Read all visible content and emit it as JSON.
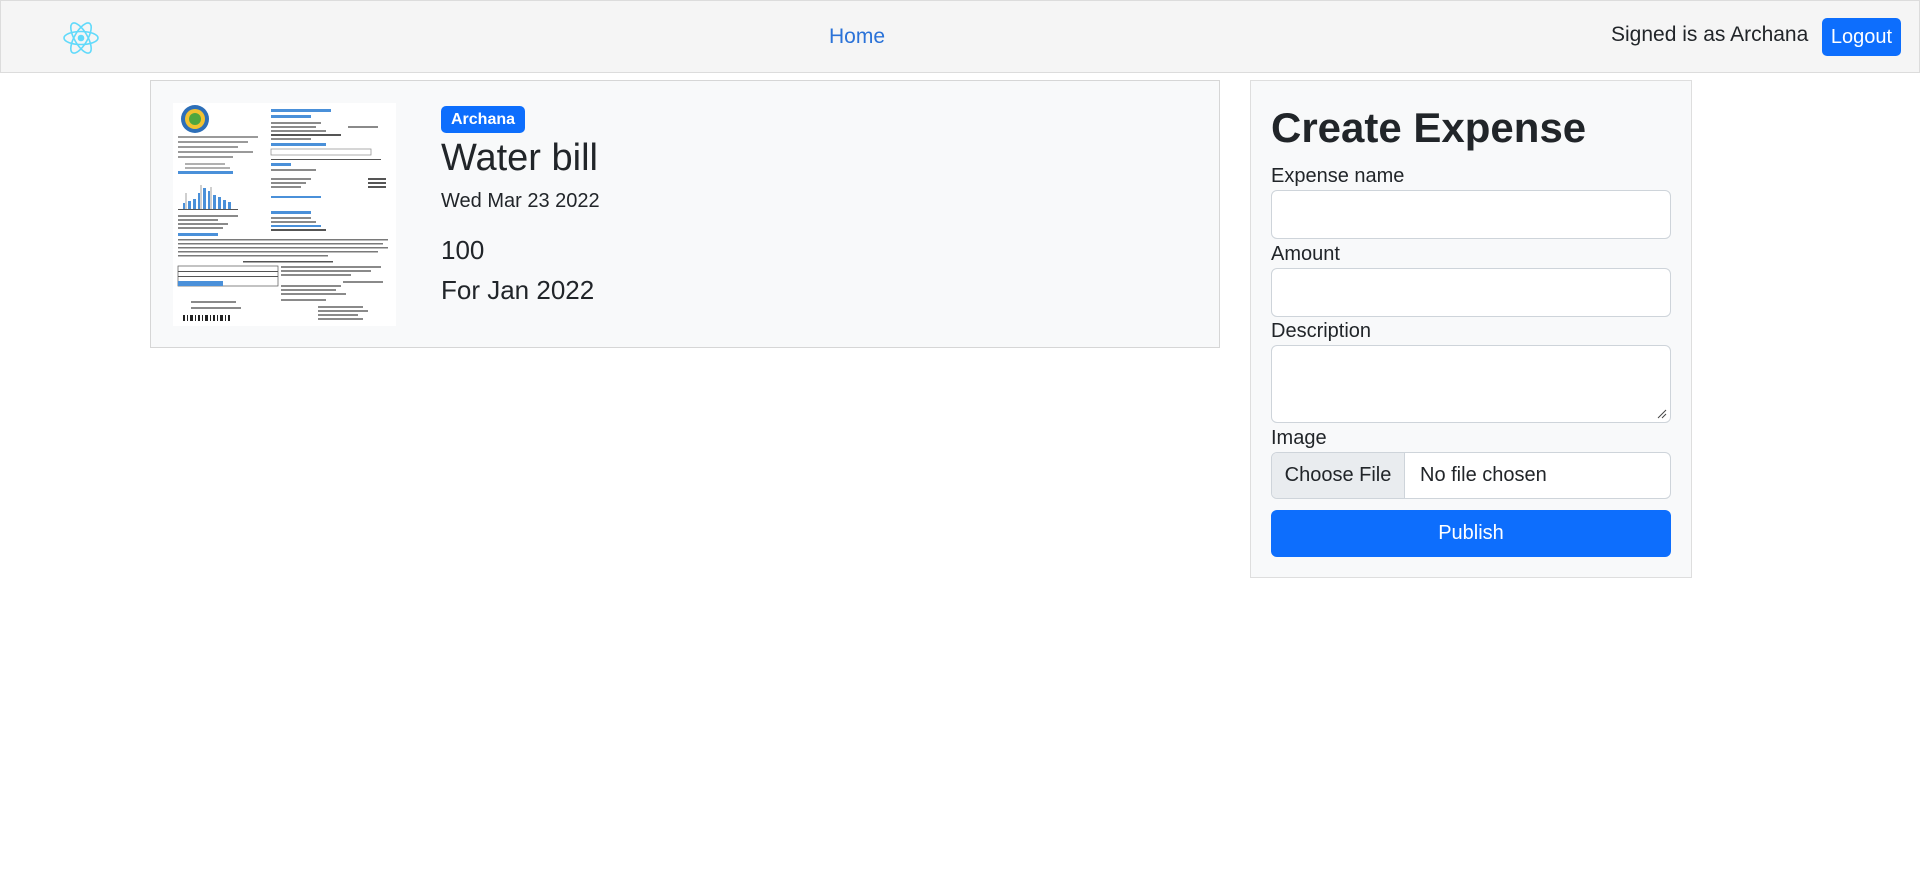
{
  "navbar": {
    "logo_icon": "react-logo-icon",
    "home_link": "Home",
    "signed_in_text": "Signed is as Archana",
    "logout_label": "Logout"
  },
  "expense": {
    "author_badge": "Archana",
    "title": "Water bill",
    "date": "Wed Mar 23 2022",
    "amount": "100",
    "description": "For Jan 2022"
  },
  "form": {
    "title": "Create Expense",
    "name_label": "Expense name",
    "amount_label": "Amount",
    "description_label": "Description",
    "image_label": "Image",
    "file_button_label": "Choose File",
    "file_status": "No file chosen",
    "publish_label": "Publish"
  },
  "colors": {
    "primary": "#0d6efd",
    "link": "#2a72d8",
    "react_cyan": "#61dafb"
  }
}
